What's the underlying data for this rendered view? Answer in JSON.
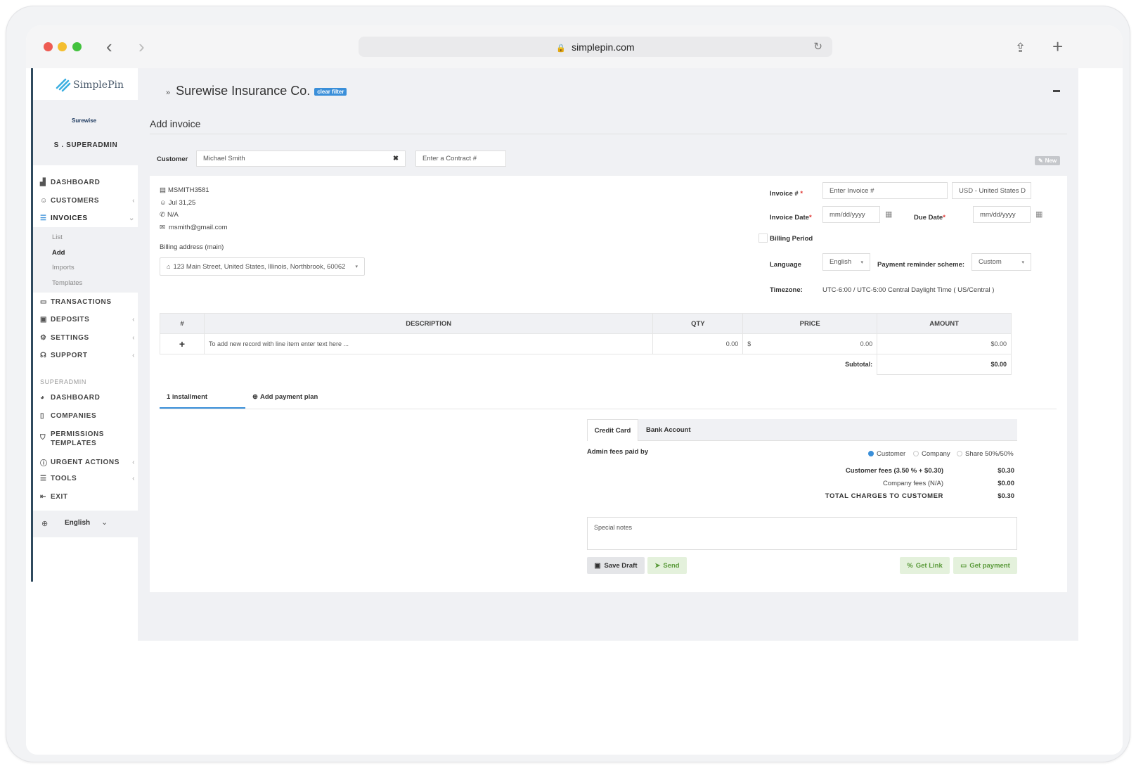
{
  "browser": {
    "url": "simplepin.com"
  },
  "sidebar": {
    "brand": "SimplePin",
    "company_logo": "Surewise",
    "user": "S . SUPERADMIN",
    "nav": [
      "DASHBOARD",
      "CUSTOMERS",
      "INVOICES"
    ],
    "invoices_sub": [
      "List",
      "Add",
      "Imports",
      "Templates"
    ],
    "nav2": [
      "TRANSACTIONS",
      "DEPOSITS",
      "SETTINGS",
      "SUPPORT"
    ],
    "section": "SUPERADMIN",
    "nav3": [
      "DASHBOARD",
      "COMPANIES",
      "PERMISSIONS",
      "TEMPLATES",
      "URGENT ACTIONS",
      "TOOLS",
      "EXIT"
    ],
    "language": "English"
  },
  "header": {
    "title": "Surewise Insurance Co.",
    "clear_filter": "clear filter",
    "section": "Add invoice"
  },
  "customer": {
    "label": "Customer",
    "value": "Michael Smith",
    "contract_placeholder": "Enter a Contract #",
    "new_badge": "New",
    "id": "MSMITH3581",
    "date": "Jul 31,25",
    "phone": "N/A",
    "email": "msmith@gmail.com",
    "billing_label": "Billing address (main)",
    "billing_address": "123 Main Street, United States, Illinois, Northbrook, 60062"
  },
  "invoice": {
    "number_label": "Invoice #",
    "number_placeholder": "Enter Invoice #",
    "currency": "USD - United States D",
    "date_label": "Invoice Date",
    "date_placeholder": "mm/dd/yyyy",
    "due_label": "Due Date",
    "due_placeholder": "mm/dd/yyyy",
    "billing_period": "Billing Period",
    "language_label": "Language",
    "language": "English",
    "reminder_label": "Payment reminder scheme:",
    "reminder": "Custom",
    "timezone_label": "Timezone:",
    "timezone": "UTC-6:00 / UTC-5:00 Central Daylight Time ( US/Central )"
  },
  "items": {
    "headers": [
      "#",
      "DESCRIPTION",
      "QTY",
      "PRICE",
      "AMOUNT"
    ],
    "row": {
      "add": "+",
      "placeholder": "To add new record with line item enter text here ...",
      "qty": "0.00",
      "currency": "$",
      "price": "0.00",
      "amount": "$0.00"
    },
    "subtotal_label": "Subtotal:",
    "subtotal": "$0.00"
  },
  "tabs": {
    "installment": "1 installment",
    "add_plan": "Add payment plan"
  },
  "payment": {
    "tabs": [
      "Credit Card",
      "Bank Account"
    ],
    "fees_label": "Admin fees paid by",
    "options": [
      "Customer",
      "Company",
      "Share 50%/50%"
    ],
    "customer_fees_label": "Customer fees (3.50 % + $0.30)",
    "customer_fees": "$0.30",
    "company_fees_label": "Company fees (N/A)",
    "company_fees": "$0.00",
    "total_label": "TOTAL CHARGES TO CUSTOMER",
    "total": "$0.30",
    "notes_placeholder": "Special notes"
  },
  "actions": {
    "save_draft": "Save Draft",
    "send": "Send",
    "get_link": "Get Link",
    "get_payment": "Get payment"
  }
}
